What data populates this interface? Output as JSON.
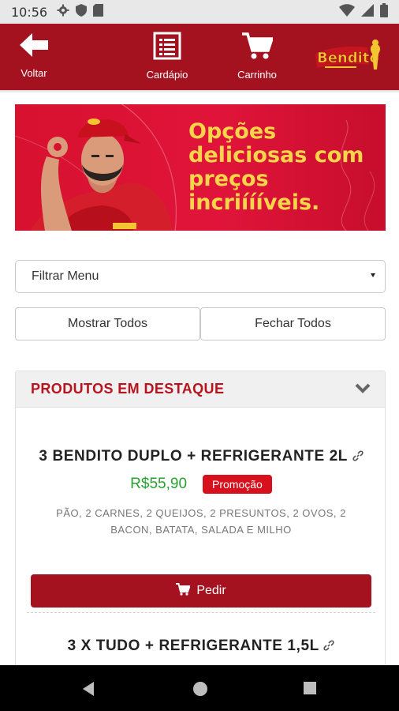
{
  "status_bar": {
    "time": "10:56",
    "left_icons": [
      "gear-icon",
      "shield-icon",
      "sd-card-icon"
    ],
    "right_icons": [
      "wifi-icon",
      "signal-icon",
      "battery-icon"
    ]
  },
  "app_bar": {
    "background": "#a5121f",
    "nav": [
      {
        "label": "Voltar",
        "icon": "arrow-left-icon"
      },
      {
        "label": "Cardápio",
        "icon": "menu-list-icon"
      },
      {
        "label": "Carrinho",
        "icon": "cart-icon"
      }
    ],
    "logo_text": "Bendito"
  },
  "banner": {
    "headline": "Opções deliciosas com preços incriíííveis.",
    "text_color": "#f6d54a"
  },
  "filter": {
    "selected": "Filtrar Menu"
  },
  "actions": {
    "show_all": "Mostrar Todos",
    "close_all": "Fechar Todos"
  },
  "featured": {
    "title": "PRODUTOS EM DESTAQUE",
    "products": [
      {
        "name": "3 BENDITO DUPLO + REFRIGERANTE 2L",
        "price": "R$55,90",
        "badge": "Promoção",
        "description": "PÃO, 2 CARNES, 2 QUEIJOS, 2 PRESUNTOS, 2 OVOS, 2 BACON, BATATA, SALADA E MILHO",
        "order_label": "Pedir"
      },
      {
        "name": "3 X TUDO + REFRIGERANTE 1,5L"
      }
    ]
  },
  "colors": {
    "brand_red": "#a5121f",
    "price_green": "#27a12f",
    "promo_red": "#d6101c"
  }
}
